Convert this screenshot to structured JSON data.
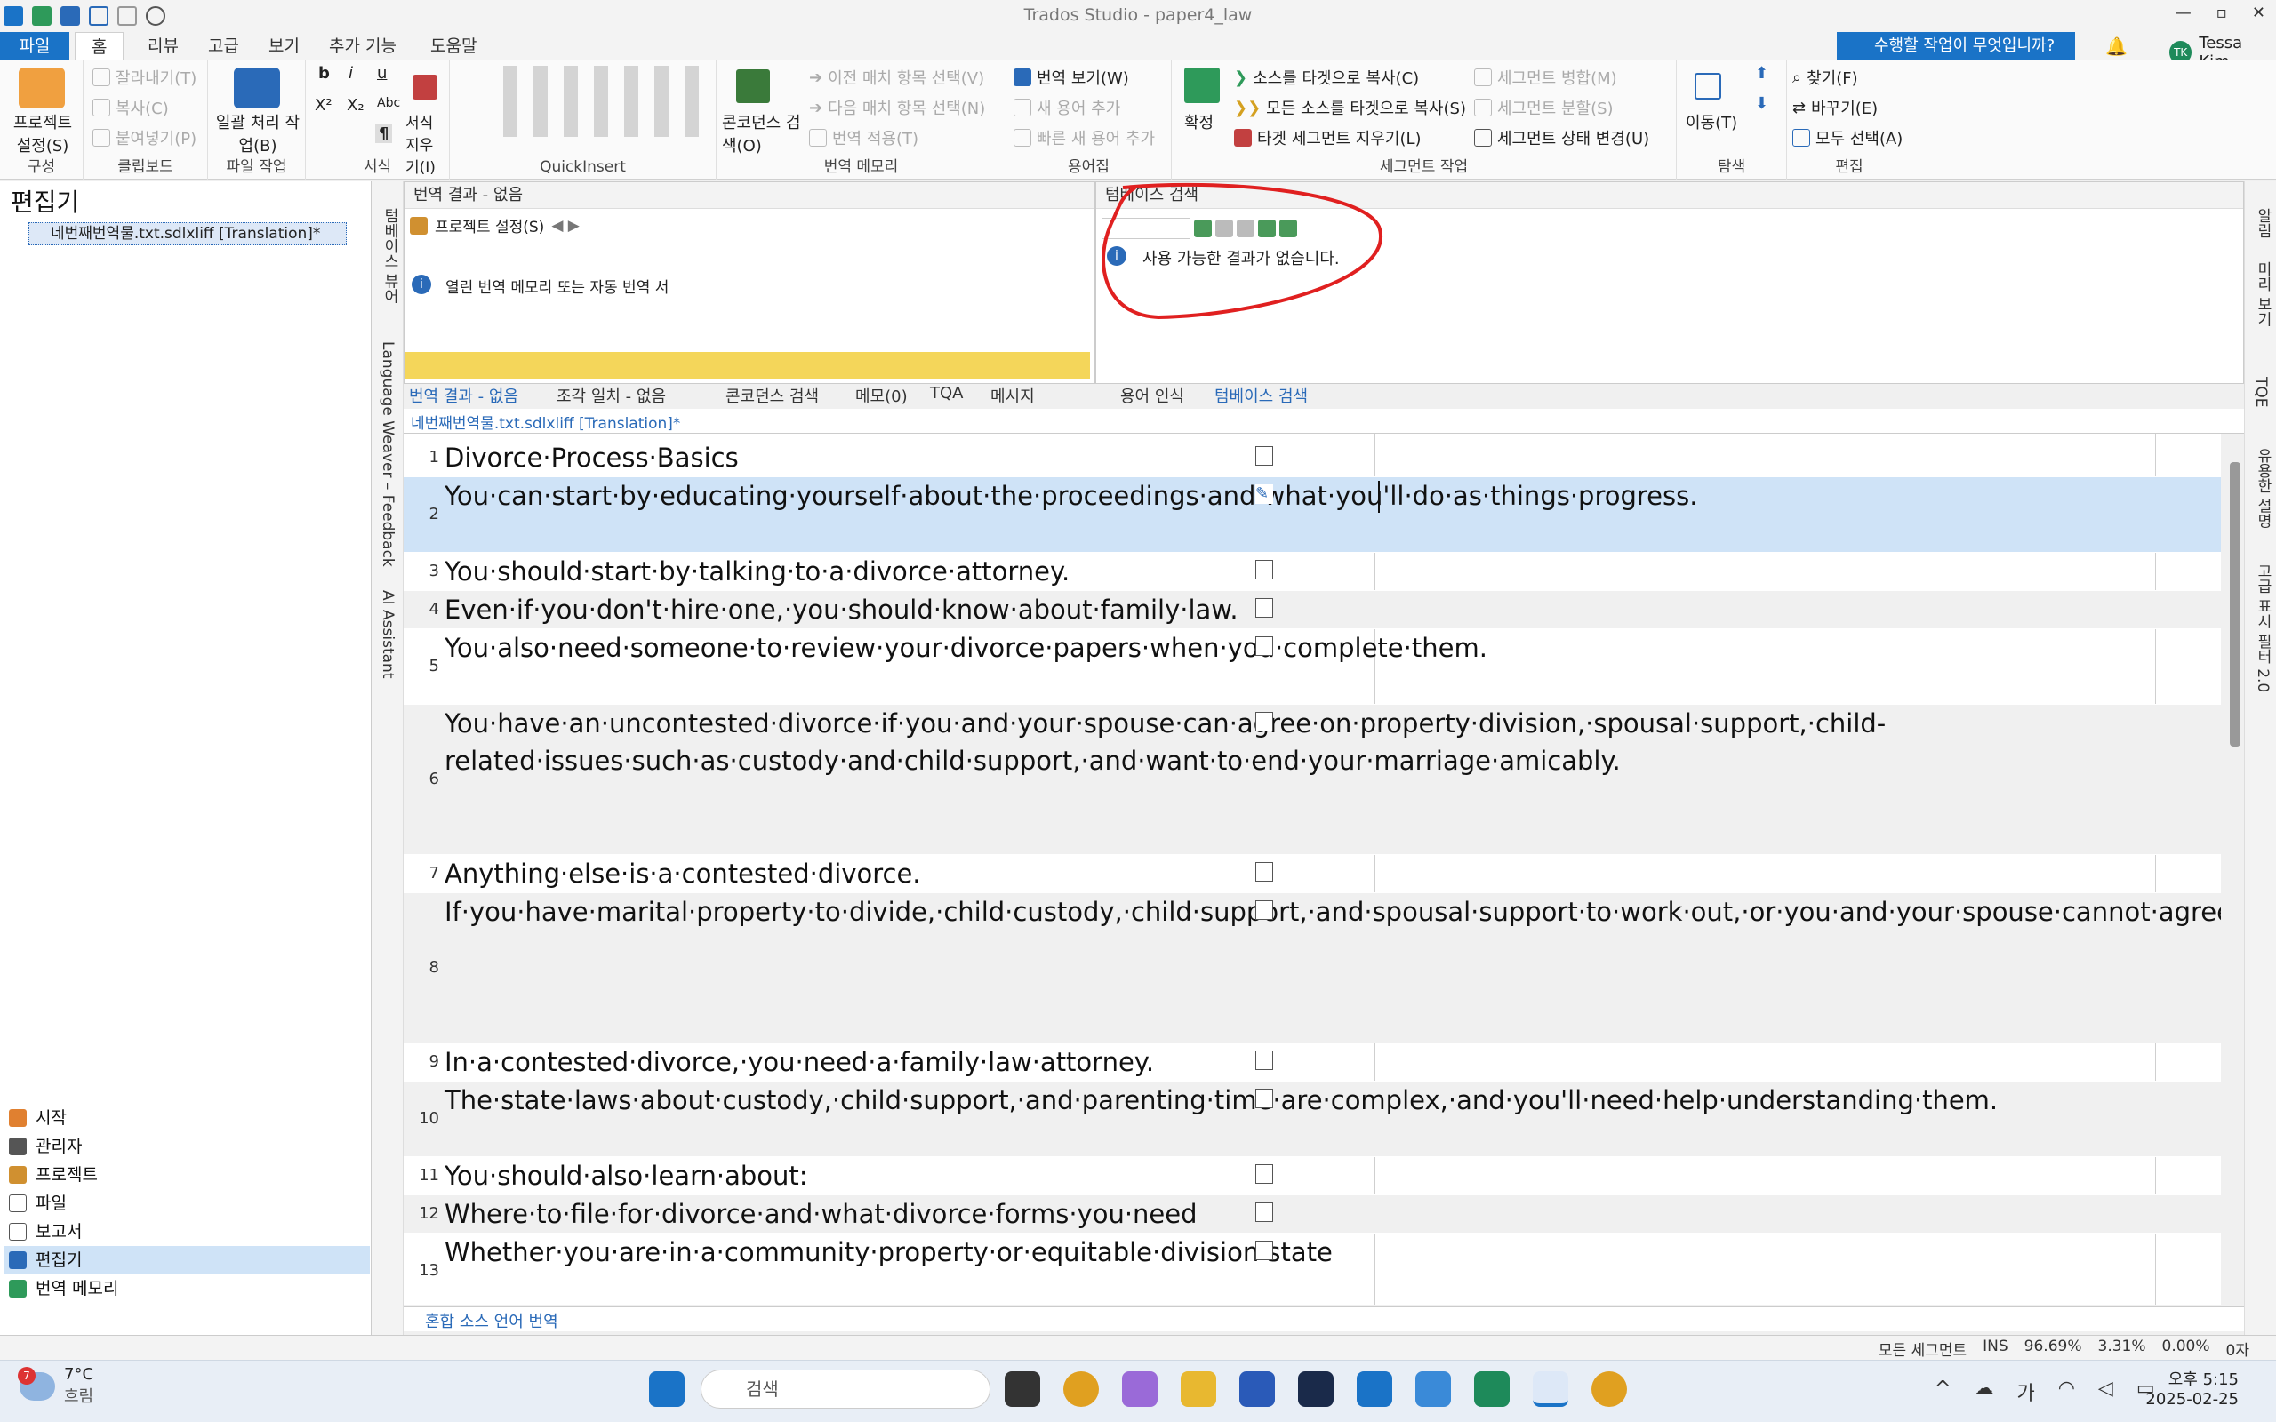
{
  "window": {
    "title": "Trados Studio - paper4_law"
  },
  "tabs": [
    {
      "label": "파일"
    },
    {
      "label": "홈"
    },
    {
      "label": "리뷰"
    },
    {
      "label": "고급"
    },
    {
      "label": "보기"
    },
    {
      "label": "추가 기능"
    },
    {
      "label": "도움말"
    }
  ],
  "help": {
    "label": "수행할 작업이 무엇입니까?"
  },
  "user": {
    "initials": "TK",
    "name": "Tessa Kim"
  },
  "ribbon": {
    "config": {
      "btn": "프로젝트 설정(S)",
      "group": "구성"
    },
    "clipboard": {
      "cut": "잘라내기(T)",
      "copy": "복사(C)",
      "paste": "붙여넣기(P)",
      "group": "클립보드"
    },
    "file": {
      "btn": "일괄 처리 작업(B)",
      "group": "파일 작업"
    },
    "format": {
      "clear": "서식 지우기(I)",
      "group": "서식",
      "b": "b",
      "i": "i",
      "u": "u",
      "sup": "X²",
      "sub": "X₂",
      "abc": "Abc",
      "pilcrow": "¶"
    },
    "qi": {
      "group": "QuickInsert"
    },
    "tm": {
      "concordance": "콘코던스 검색(O)",
      "prev": "이전 매치 항목 선택(V)",
      "next": "다음 매치 항목 선택(N)",
      "apply": "번역 적용(T)",
      "group": "번역 메모리"
    },
    "term": {
      "view": "번역 보기(W)",
      "add": "새 용어 추가",
      "quickadd": "빠른 새 용어 추가",
      "group": "용어집"
    },
    "seg": {
      "confirm": "확정",
      "copysrc": "소스를 타겟으로 복사(C)",
      "copyall": "모든 소스를 타겟으로 복사(S)",
      "clear": "타겟 세그먼트 지우기(L)",
      "merge": "세그먼트 병합(M)",
      "split": "세그먼트 분할(S)",
      "status": "세그먼트 상태 변경(U)",
      "group": "세그먼트 작업"
    },
    "nav": {
      "move": "이동(T)",
      "group": "탐색"
    },
    "edit": {
      "find": "찾기(F)",
      "replace": "바꾸기(E)",
      "selectall": "모두 선택(A)",
      "group": "편집"
    }
  },
  "left": {
    "title": "편집기",
    "file": "네번째번역물.txt.sdlxliff [Translation]*",
    "nav": [
      {
        "label": "시작"
      },
      {
        "label": "관리자"
      },
      {
        "label": "프로젝트"
      },
      {
        "label": "파일"
      },
      {
        "label": "보고서"
      },
      {
        "label": "편집기"
      },
      {
        "label": "번역 메모리"
      }
    ]
  },
  "vstrip": {
    "t1": "텀베이스 뷰어",
    "t2": "Language Weaver – Feedback",
    "t3": "AI Assistant"
  },
  "rstrip": {
    "t1": "알림",
    "t2": "미리 보기",
    "t3": "TQE",
    "t4": "유용한 설명",
    "t5": "고급 표시 필터 2.0"
  },
  "tm": {
    "title": "번역 결과 - 없음",
    "settings": "프로젝트 설정(S)",
    "msg": "열린 번역 메모리 또는 자동 번역 서"
  },
  "tb": {
    "title": "텀베이스 검색",
    "msg": "사용 가능한 결과가 없습니다."
  },
  "paneltabs": [
    {
      "label": "번역 결과 - 없음"
    },
    {
      "label": "조각 일치 - 없음"
    },
    {
      "label": "콘코던스 검색"
    },
    {
      "label": "메모(0)"
    },
    {
      "label": "TQA"
    },
    {
      "label": "메시지"
    },
    {
      "label": "용어 인식"
    },
    {
      "label": "텀베이스 검색"
    }
  ],
  "doc": {
    "tab": "네번째번역물.txt.sdlxliff [Translation]*"
  },
  "segments": [
    {
      "n": "1",
      "src": "Divorce·Process·Basics"
    },
    {
      "n": "2",
      "src": "You·can·start·by·educating·yourself·about·the·proceedings·and·what·you'll·do·as·things·progress."
    },
    {
      "n": "3",
      "src": "You·should·start·by·talking·to·a·divorce·attorney."
    },
    {
      "n": "4",
      "src": "Even·if·you·don't·hire·one,·you·should·know·about·family·law."
    },
    {
      "n": "5",
      "src": "You·also·need·someone·to·review·your·divorce·papers·when·you·complete·them."
    },
    {
      "n": "6",
      "src": "You·have·an·uncontested·divorce·if·you·and·your·spouse·can·agree·on·property·division,·spousal·support,·child-related·issues·such·as·custody·and·child·support,·and·want·to·end·your·marriage·amicably."
    },
    {
      "n": "7",
      "src": "Anything·else·is·a·contested·divorce."
    },
    {
      "n": "8",
      "src": "If·you·have·marital·property·to·divide,·child·custody,·child·support,·and·spousal·support·to·work·out,·or·you·and·your·spouse·cannot·agree·on·what·to·do,·you·have·a·contested·divorce."
    },
    {
      "n": "9",
      "src": "In·a·contested·divorce,·you·need·a·family·law·attorney."
    },
    {
      "n": "10",
      "src": "The·state·laws·about·custody,·child·support,·and·parenting·time·are·complex,·and·you'll·need·help·understanding·them."
    },
    {
      "n": "11",
      "src": "You·should·also·learn·about:"
    },
    {
      "n": "12",
      "src": "Where·to·file·for·divorce·and·what·divorce·forms·you·need"
    },
    {
      "n": "13",
      "src": "Whether·you·are·in·a·community·property·or·equitable·division·state"
    }
  ],
  "mixed": {
    "label": "혼합 소스 언어 번역"
  },
  "status": {
    "filter": "모든 세그먼트",
    "ins": "INS",
    "p1": "96.69%",
    "p2": "3.31%",
    "p3": "0.00%",
    "chars": "0자"
  },
  "taskbar": {
    "temp": "7°C",
    "weather": "흐림",
    "badge": "7",
    "search": "검색",
    "time": "오후 5:15",
    "date": "2025-02-25",
    "ime": "가"
  },
  "colors": {
    "accent": "#1a73c7",
    "active_row": "#cfe3f7",
    "annotation": "#e02020",
    "highlight": "#f4d65a"
  }
}
